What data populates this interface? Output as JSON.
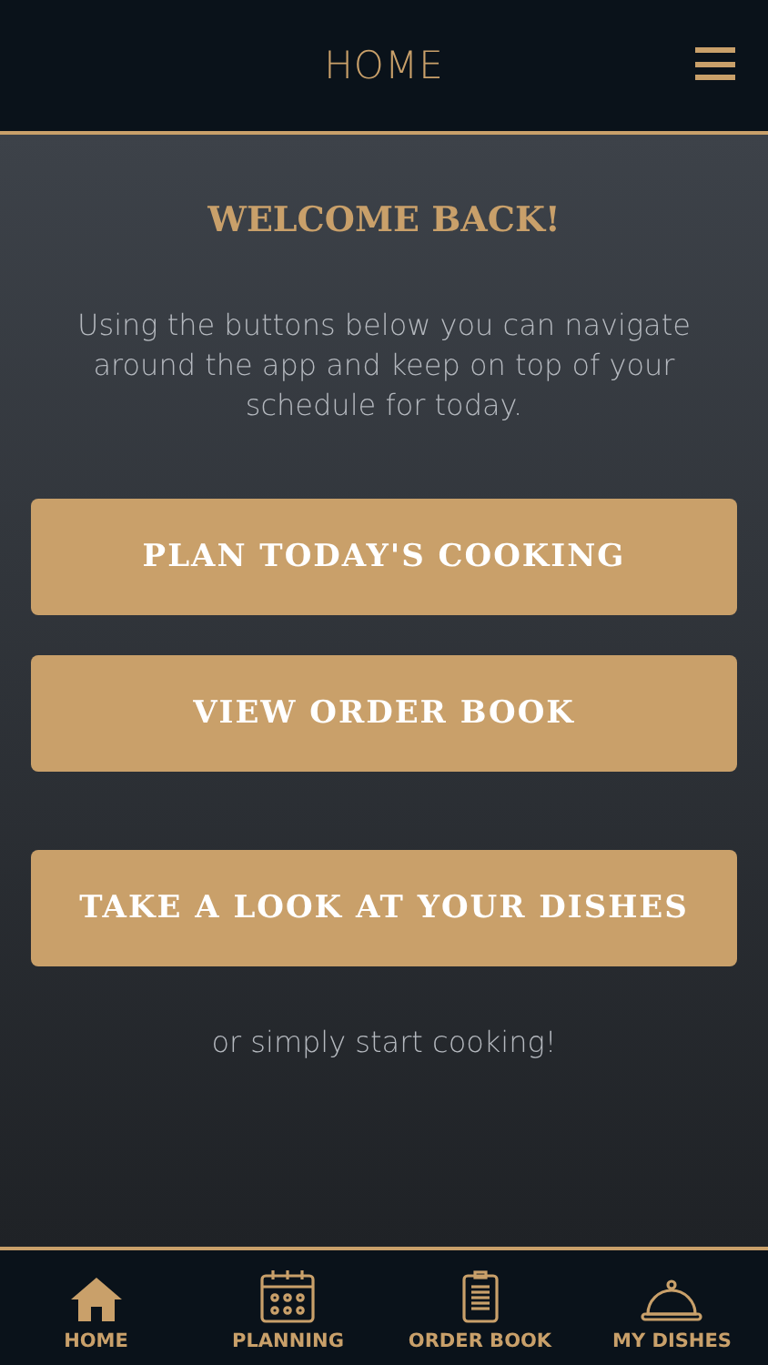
{
  "header": {
    "title": "HOME"
  },
  "welcome": {
    "heading": "WELCOME BACK!",
    "text": "Using the buttons below you can navigate around the app and keep on top of your schedule for today."
  },
  "buttons": [
    {
      "label": "PLAN TODAY'S COOKING"
    },
    {
      "label": "VIEW ORDER BOOK"
    },
    {
      "label": "TAKE A LOOK AT YOUR DISHES"
    }
  ],
  "footer_text": "or simply start cooking!",
  "nav": [
    {
      "kind": "home",
      "label": "HOME"
    },
    {
      "kind": "planning",
      "label": "PLANNING"
    },
    {
      "kind": "orders",
      "label": "ORDER BOOK"
    },
    {
      "kind": "dishes",
      "label": "MY DISHES"
    }
  ]
}
